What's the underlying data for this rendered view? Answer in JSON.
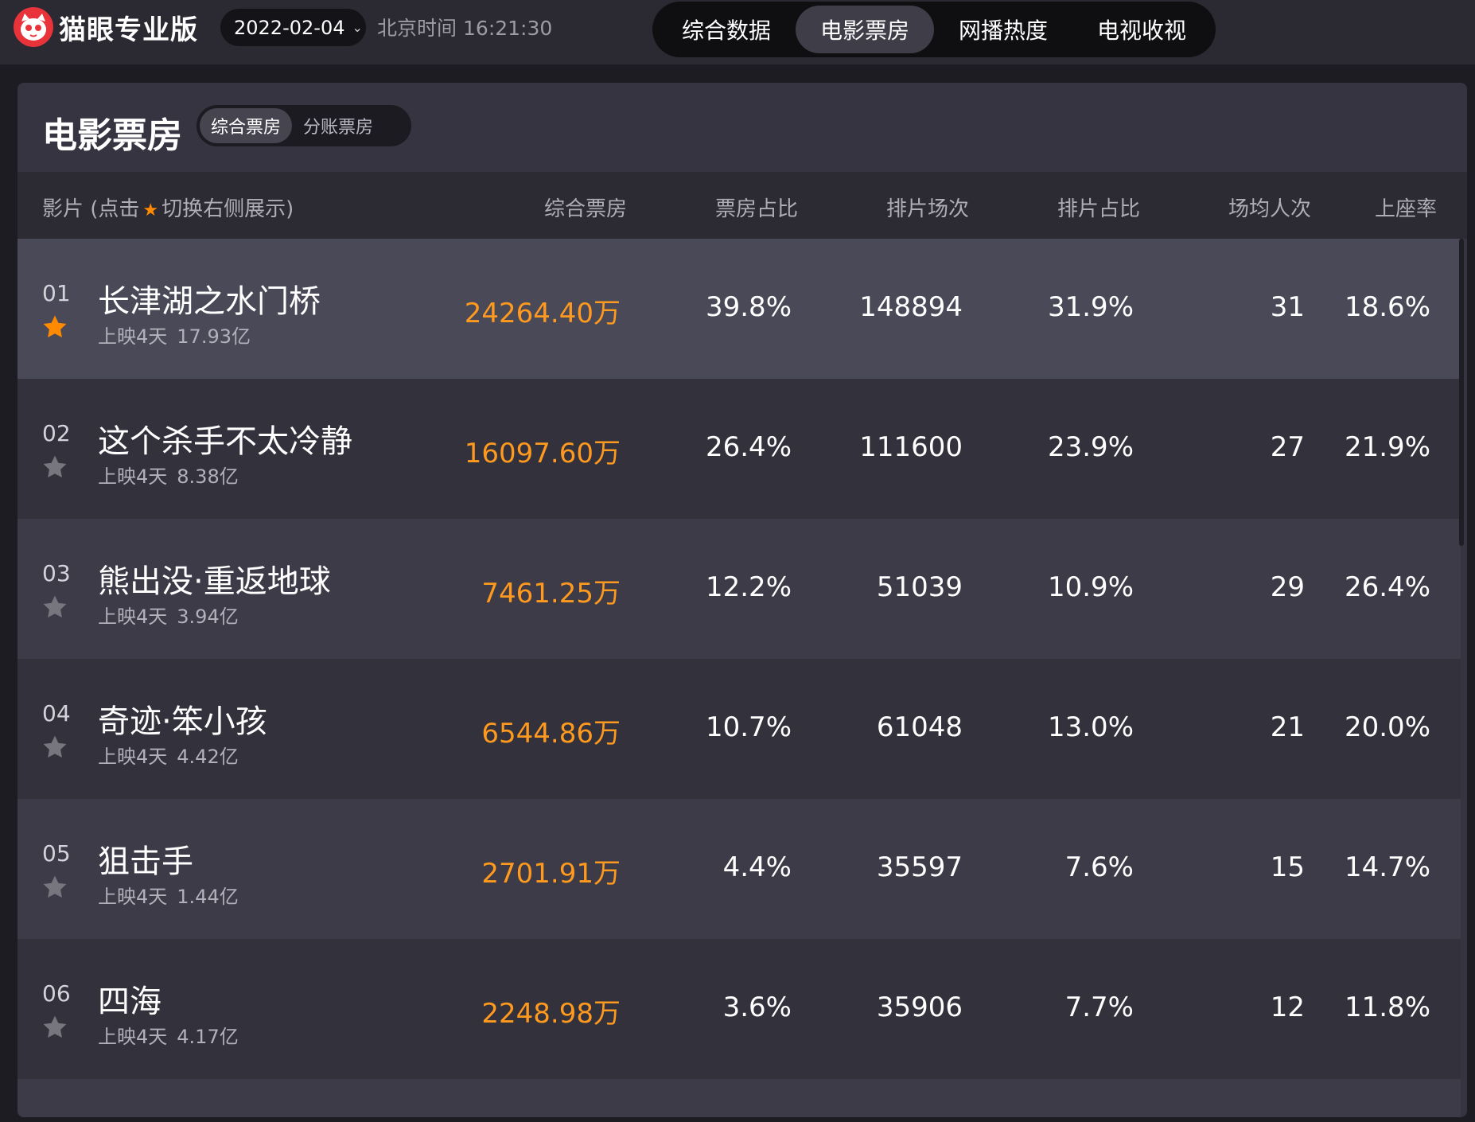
{
  "app": {
    "logo_text": "猫眼专业版",
    "date": "2022-02-04",
    "clock_label": "北京时间",
    "clock_time": "16:21:30"
  },
  "nav": [
    {
      "label": "综合数据",
      "active": false
    },
    {
      "label": "电影票房",
      "active": true
    },
    {
      "label": "网播热度",
      "active": false
    },
    {
      "label": "电视收视",
      "active": false
    }
  ],
  "panel": {
    "title": "电影票房",
    "toggle": [
      {
        "label": "综合票房",
        "active": true
      },
      {
        "label": "分账票房",
        "active": false
      }
    ]
  },
  "columns": {
    "film_prefix": "影片 (点击",
    "film_suffix": "切换右侧展示)",
    "box_office": "综合票房",
    "box_share": "票房占比",
    "screenings": "排片场次",
    "screening_share": "排片占比",
    "avg_attendance": "场均人次",
    "occupancy": "上座率"
  },
  "rows": [
    {
      "rank": "01",
      "title": "长津湖之水门桥",
      "days": "上映4天",
      "total": "17.93亿",
      "box_office": "24264.40万",
      "box_share": "39.8%",
      "screenings": "148894",
      "screening_share": "31.9%",
      "avg_attendance": "31",
      "occupancy": "18.6%",
      "starred": true
    },
    {
      "rank": "02",
      "title": "这个杀手不太冷静",
      "days": "上映4天",
      "total": "8.38亿",
      "box_office": "16097.60万",
      "box_share": "26.4%",
      "screenings": "111600",
      "screening_share": "23.9%",
      "avg_attendance": "27",
      "occupancy": "21.9%",
      "starred": false
    },
    {
      "rank": "03",
      "title": "熊出没·重返地球",
      "days": "上映4天",
      "total": "3.94亿",
      "box_office": "7461.25万",
      "box_share": "12.2%",
      "screenings": "51039",
      "screening_share": "10.9%",
      "avg_attendance": "29",
      "occupancy": "26.4%",
      "starred": false
    },
    {
      "rank": "04",
      "title": "奇迹·笨小孩",
      "days": "上映4天",
      "total": "4.42亿",
      "box_office": "6544.86万",
      "box_share": "10.7%",
      "screenings": "61048",
      "screening_share": "13.0%",
      "avg_attendance": "21",
      "occupancy": "20.0%",
      "starred": false
    },
    {
      "rank": "05",
      "title": "狙击手",
      "days": "上映4天",
      "total": "1.44亿",
      "box_office": "2701.91万",
      "box_share": "4.4%",
      "screenings": "35597",
      "screening_share": "7.6%",
      "avg_attendance": "15",
      "occupancy": "14.7%",
      "starred": false
    },
    {
      "rank": "06",
      "title": "四海",
      "days": "上映4天",
      "total": "4.17亿",
      "box_office": "2248.98万",
      "box_share": "3.6%",
      "screenings": "35906",
      "screening_share": "7.7%",
      "avg_attendance": "12",
      "occupancy": "11.8%",
      "starred": false
    }
  ],
  "colors": {
    "accent_orange": "#ff9a1f",
    "star_active": "#ff8a00",
    "star_inactive": "#77767f",
    "logo_red": "#e8333b"
  }
}
